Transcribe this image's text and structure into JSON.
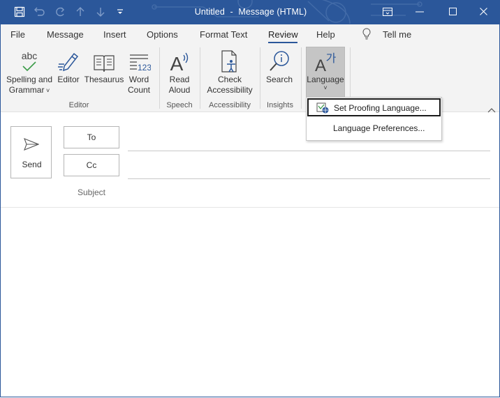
{
  "window": {
    "title_left": "Untitled",
    "title_sep": "-",
    "title_right": "Message (HTML)"
  },
  "qat": {
    "icons": [
      "save-icon",
      "undo-icon",
      "redo-icon",
      "up-arrow-icon",
      "down-arrow-icon",
      "customize-qat-icon"
    ]
  },
  "menu": {
    "items": [
      "File",
      "Message",
      "Insert",
      "Options",
      "Format Text",
      "Review",
      "Help"
    ],
    "active": "Review",
    "tell_me": "Tell me"
  },
  "ribbon": {
    "spelling": {
      "line1": "Spelling and",
      "line2": "Grammar",
      "icon_text": "abc"
    },
    "editor": "Editor",
    "thesaurus": "Thesaurus",
    "word_count": {
      "line1": "Word",
      "line2": "Count",
      "icon_text": "123"
    },
    "read_aloud": {
      "line1": "Read",
      "line2": "Aloud"
    },
    "check_accessibility": {
      "line1": "Check",
      "line2": "Accessibility"
    },
    "search": "Search",
    "language": {
      "label": "Language",
      "icon_text": "A",
      "icon_glyph": "가"
    },
    "groups": {
      "editor": "Editor",
      "speech": "Speech",
      "accessibility": "Accessibility",
      "insights": "Insights"
    }
  },
  "dropdown": {
    "set_proofing": "Set Proofing Language...",
    "preferences": "Language Preferences..."
  },
  "compose": {
    "send": "Send",
    "to": "To",
    "cc": "Cc",
    "subject": "Subject"
  },
  "colors": {
    "titlebar": "#2b579a",
    "ribbon": "#f3f3f3",
    "accent_green": "#3b9b48",
    "accent_blue": "#2b579a"
  }
}
